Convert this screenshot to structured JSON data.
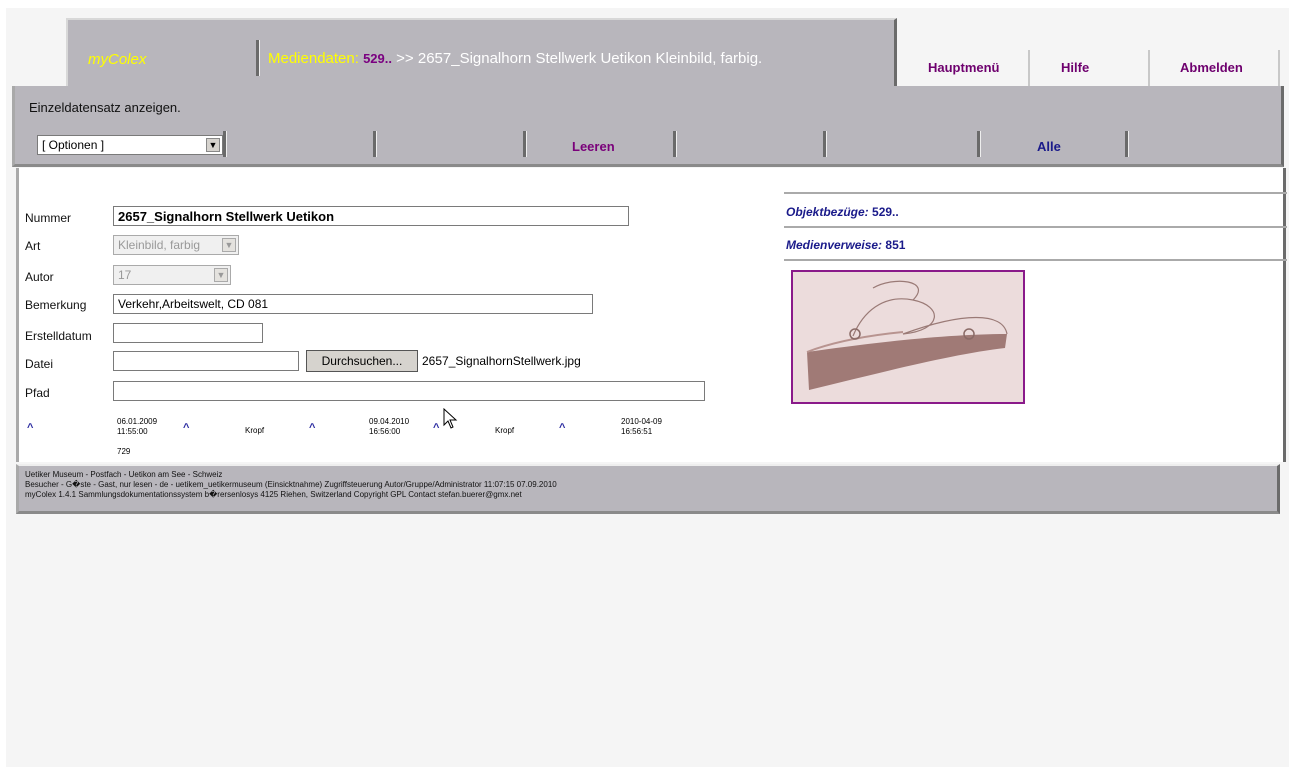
{
  "header": {
    "brand": "myColex",
    "title_label": "Mediendaten:",
    "title_number": "529..",
    "title_rest": ">> 2657_Signalhorn Stellwerk Uetikon Kleinbild, farbig."
  },
  "top_nav": {
    "main_menu": "Hauptmenü",
    "help": "Hilfe",
    "logout": "Abmelden"
  },
  "toolbar": {
    "description": "Einzeldatensatz anzeigen.",
    "options_value": "[ Optionen ]",
    "clear": "Leeren",
    "all": "Alle"
  },
  "form": {
    "nummer_label": "Nummer",
    "nummer_value": "2657_Signalhorn Stellwerk Uetikon",
    "art_label": "Art",
    "art_value": "Kleinbild, farbig",
    "autor_label": "Autor",
    "autor_value": "17",
    "bemerkung_label": "Bemerkung",
    "bemerkung_value": "Verkehr,Arbeitswelt, CD 081",
    "erstelldatum_label": "Erstelldatum",
    "erstelldatum_value": "",
    "datei_label": "Datei",
    "datei_value": "",
    "browse_label": "Durchsuchen...",
    "file_name": "2657_SignalhornStellwerk.jpg",
    "pfad_label": "Pfad",
    "pfad_value": ""
  },
  "meta": {
    "caret": "^",
    "created_date": "06.01.2009",
    "created_time": "11:55:00",
    "created_by": "Kropf",
    "modified_date": "09.04.2010",
    "modified_time": "16:56:00",
    "modified_by": "Kropf",
    "stamp_date": "2010-04-09",
    "stamp_time": "16:56:51",
    "id": "729"
  },
  "side": {
    "objekt_label": "Objektbezüge:",
    "objekt_value": "529..",
    "medien_label": "Medienverweise:",
    "medien_value": "851"
  },
  "footer": {
    "line1": "Uetiker Museum - Postfach - Uetikon am See - Schweiz",
    "line2": "Besucher - G�ste - Gast, nur lesen - de - uetikem_uetikermuseum (Einsicktnahme) Zugriffsteuerung Autor/Gruppe/Administrator 11:07:15 07.09.2010",
    "line3": "myColex 1.4.1 Sammlungsdokumentationssystem b�rersenlosys 4125 Riehen, Switzerland Copyright GPL Contact stefan.buerer@gmx.net"
  },
  "colors": {
    "band": "#b8b6bc",
    "brand_yellow": "#ffff00",
    "link_purple": "#6e006e",
    "link_navy": "#1a1a8a"
  }
}
